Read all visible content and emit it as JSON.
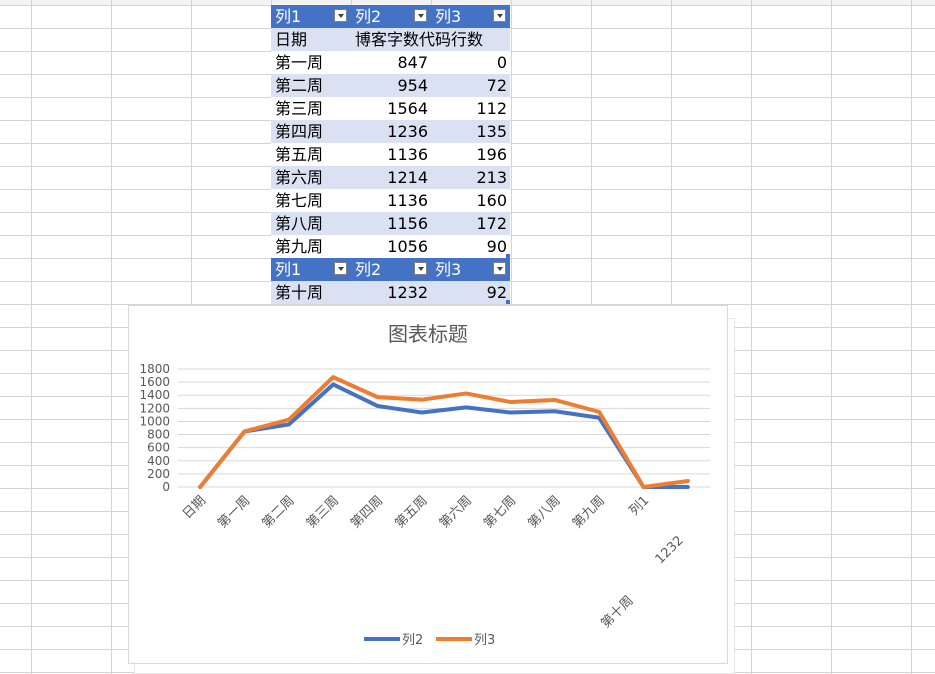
{
  "sheet": {
    "table_header": [
      "列1",
      "列2",
      "列3"
    ],
    "rows": [
      [
        "日期",
        "博客字数代码行数",
        ""
      ],
      [
        "第一周",
        "847",
        "0"
      ],
      [
        "第二周",
        "954",
        "72"
      ],
      [
        "第三周",
        "1564",
        "112"
      ],
      [
        "第四周",
        "1236",
        "135"
      ],
      [
        "第五周",
        "1136",
        "196"
      ],
      [
        "第六周",
        "1214",
        "213"
      ],
      [
        "第七周",
        "1136",
        "160"
      ],
      [
        "第八周",
        "1156",
        "172"
      ],
      [
        "第九周",
        "1056",
        "90"
      ]
    ],
    "second_header": [
      "列1",
      "列2",
      "列3"
    ],
    "last_row": [
      "第十周",
      "1232",
      "92"
    ]
  },
  "chart_data": {
    "type": "line",
    "title": "图表标题",
    "stacked": true,
    "categories": [
      "日期",
      "第一周",
      "第二周",
      "第三周",
      "第四周",
      "第五周",
      "第六周",
      "第七周",
      "第八周",
      "第九周",
      "列1",
      "1232\n第十周"
    ],
    "category_labels": [
      "日期",
      "第一周",
      "第二周",
      "第三周",
      "第四周",
      "第五周",
      "第六周",
      "第七周",
      "第八周",
      "第九周",
      "列1",
      "1232",
      "第十周"
    ],
    "series": [
      {
        "name": "列2",
        "color": "#4472c4",
        "values": [
          0,
          847,
          954,
          1564,
          1236,
          1136,
          1214,
          1136,
          1156,
          1056,
          0,
          0
        ]
      },
      {
        "name": "列3",
        "color": "#ed7d31",
        "values": [
          0,
          0,
          72,
          112,
          135,
          196,
          213,
          160,
          172,
          90,
          0,
          92
        ]
      }
    ],
    "ylim": [
      0,
      1800
    ],
    "yticks": [
      0,
      200,
      400,
      600,
      800,
      1000,
      1200,
      1400,
      1600,
      1800
    ],
    "grid": true,
    "legend_position": "bottom"
  },
  "colors": {
    "header_bg": "#4472c4",
    "band_bg": "#d9e1f2",
    "gridline": "#d9d9d9"
  }
}
